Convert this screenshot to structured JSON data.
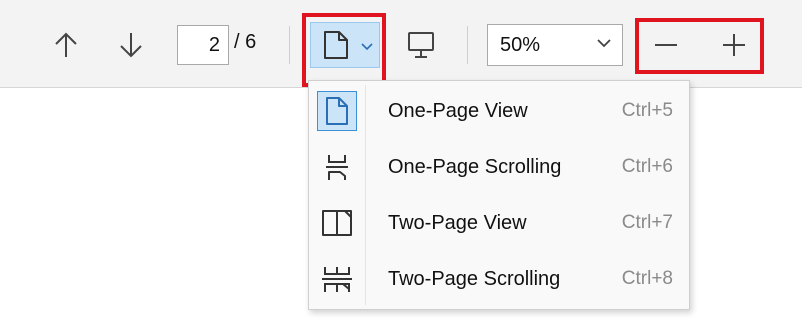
{
  "toolbar": {
    "page_current": "2",
    "page_total": "/ 6",
    "zoom_value": "50%",
    "icons": {
      "prev": "arrow-up-icon",
      "next": "arrow-down-icon",
      "view": "page-view-icon",
      "present": "monitor-icon",
      "zoom_out": "minus-icon",
      "zoom_in": "plus-icon"
    }
  },
  "view_menu": {
    "items": [
      {
        "label": "One-Page View",
        "shortcut": "Ctrl+5",
        "icon": "one-page-view-icon",
        "selected": true
      },
      {
        "label": "One-Page Scrolling",
        "shortcut": "Ctrl+6",
        "icon": "one-page-scrolling-icon",
        "selected": false
      },
      {
        "label": "Two-Page View",
        "shortcut": "Ctrl+7",
        "icon": "two-page-view-icon",
        "selected": false
      },
      {
        "label": "Two-Page Scrolling",
        "shortcut": "Ctrl+8",
        "icon": "two-page-scrolling-icon",
        "selected": false
      }
    ]
  },
  "colors": {
    "highlight": "#e0141e",
    "selected_bg": "#cce4f7",
    "selected_border": "#3d8fd6",
    "toolbar_bg": "#f3f3f3"
  }
}
